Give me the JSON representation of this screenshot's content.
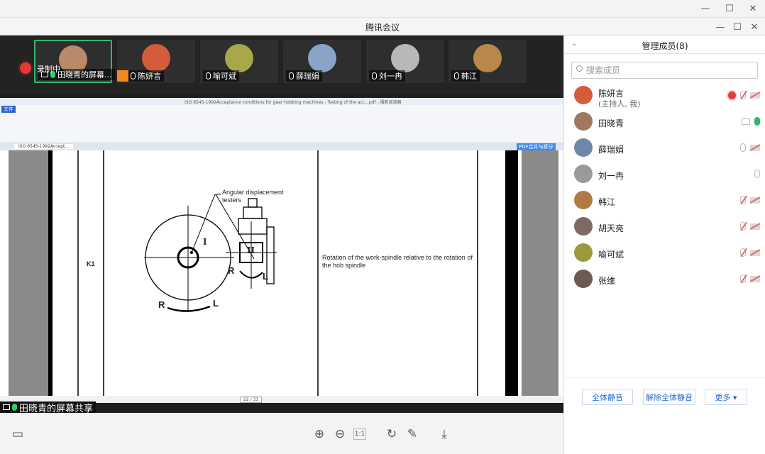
{
  "window": {
    "controls": [
      "—",
      "☐",
      "✕"
    ]
  },
  "meeting": {
    "title": "腾讯会议",
    "controls": [
      "—",
      "☐",
      "✕"
    ]
  },
  "recording": {
    "label": "录制中"
  },
  "thumbnails": [
    {
      "label": "田晓青的屏幕...",
      "color": "#b88a6a",
      "mic": "on",
      "screen": true
    },
    {
      "label": "陈妍言",
      "color": "#d45b3c",
      "mic": "muted",
      "host": true
    },
    {
      "label": "喻可斌",
      "color": "#a8a74a",
      "mic": "muted"
    },
    {
      "label": "薛瑞娟",
      "color": "#8aa4c8",
      "mic": "on"
    },
    {
      "label": "刘一冉",
      "color": "#b8b8b8",
      "mic": "on"
    },
    {
      "label": "韩江",
      "color": "#b8874a",
      "mic": "muted"
    }
  ],
  "shared_screen": {
    "label": "田晓青的屏幕共享",
    "app_title": "ISO 6545-1992Acceptance conditions for gear hobbing machines - Testing of the acc...pdf - 福昕阅读器",
    "ribbon_tab": "文件",
    "doc_tab": "ISO 6545-1992Accept...",
    "pdf_button": "PDF合并与拆分",
    "page_indicator": "22 / 33",
    "figure": {
      "code": "K1",
      "annotation": "Angular displacement testers",
      "label_R1": "R",
      "label_L1": "L",
      "label_R2": "R",
      "label_L2": "L",
      "roman1": "I",
      "roman2": "II"
    },
    "description": "Rotation of the work-spindle relative to the rotation of the hob spindle"
  },
  "panel": {
    "title": "管理成员(8)",
    "search_placeholder": "搜索成员",
    "members": [
      {
        "name": "陈妍言",
        "sub": "(主持人, 我)",
        "color": "#d45b3c",
        "rec": true,
        "mic": "muted",
        "cam": "off"
      },
      {
        "name": "田晓青",
        "sub": "",
        "color": "#a0785e",
        "screen": true,
        "mic": "on",
        "cam": ""
      },
      {
        "name": "薛瑞娟",
        "sub": "",
        "color": "#6f87a8",
        "mic": "idle",
        "cam": "off"
      },
      {
        "name": "刘一冉",
        "sub": "",
        "color": "#9a9a9a",
        "mic": "idle",
        "cam": ""
      },
      {
        "name": "韩江",
        "sub": "",
        "color": "#b07a44",
        "mic": "muted",
        "cam": "off"
      },
      {
        "name": "胡天亮",
        "sub": "",
        "color": "#7d6b63",
        "mic": "muted",
        "cam": "off"
      },
      {
        "name": "喻可斌",
        "sub": "",
        "color": "#9a9a3a",
        "mic": "muted",
        "cam": "off"
      },
      {
        "name": "张维",
        "sub": "",
        "color": "#6d5a52",
        "mic": "muted",
        "cam": "off"
      }
    ],
    "buttons": {
      "mute_all": "全体静音",
      "unmute_all": "解除全体静音",
      "more": "更多 ▾"
    }
  },
  "toolbar": {
    "layout_icon": "layout-icon",
    "zoom_in": "zoom-in-icon",
    "zoom_out": "zoom-out-icon",
    "fit": "1:1",
    "rotate": "rotate-icon",
    "annotate": "pen-icon",
    "download": "download-icon"
  }
}
